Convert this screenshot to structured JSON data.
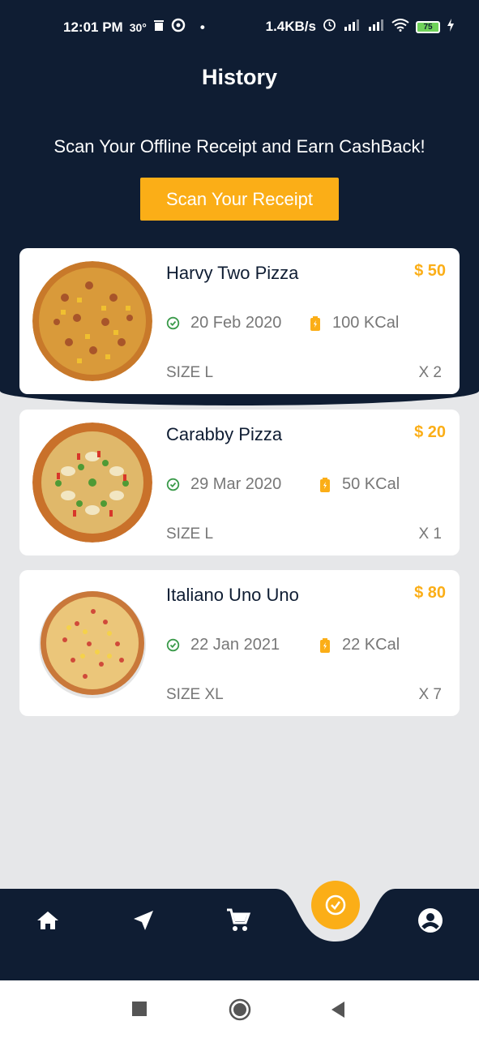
{
  "status_bar": {
    "time": "12:01 PM",
    "temp": "30°",
    "network_speed": "1.4KB/s",
    "battery": "75"
  },
  "header": {
    "title": "History"
  },
  "promo": {
    "text": "Scan Your Offline Receipt and Earn CashBack!",
    "button_label": "Scan Your Receipt"
  },
  "orders": [
    {
      "name": "Harvy Two Pizza",
      "price": "$ 50",
      "date": "20 Feb 2020",
      "calories": "100 KCal",
      "size": "SIZE L",
      "quantity": "X 2"
    },
    {
      "name": "Carabby Pizza",
      "price": "$ 20",
      "date": "29 Mar 2020",
      "calories": "50 KCal",
      "size": "SIZE L",
      "quantity": "X 1"
    },
    {
      "name": "Italiano Uno Uno",
      "price": "$ 80",
      "date": "22 Jan 2021",
      "calories": "22 KCal",
      "size": "SIZE XL",
      "quantity": "X 7"
    }
  ],
  "bottom_nav": {
    "items": [
      "home-icon",
      "navigation-icon",
      "cart-icon",
      "timer-icon",
      "account-icon"
    ],
    "active": "timer-icon"
  },
  "colors": {
    "navy": "#0f1d33",
    "accent": "#fbae17",
    "background": "#e6e7e9",
    "clock_green": "#3a9a4a"
  }
}
